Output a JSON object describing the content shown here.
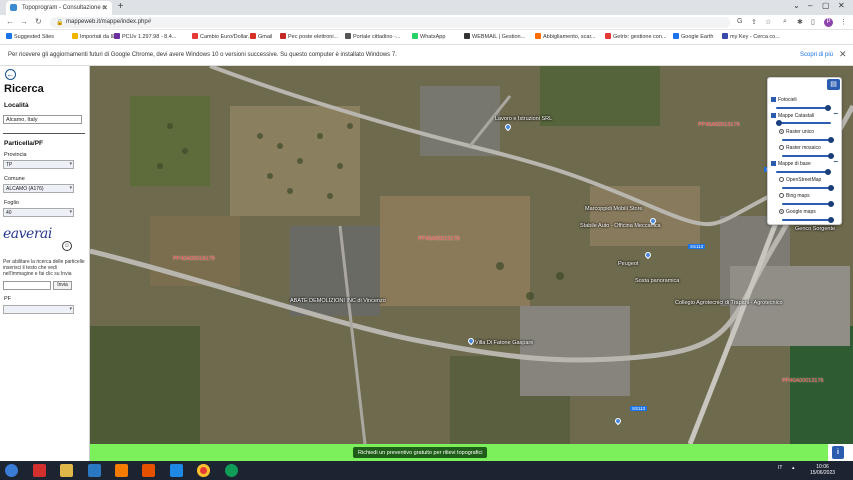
{
  "browser": {
    "tab_title": "Topoprogram - Consultazione n",
    "url": "mappeweb.it/mappe/index.php#",
    "profile_initial": "P"
  },
  "bookmarks": [
    {
      "label": "Suggested Sites",
      "color": "#1a73e8"
    },
    {
      "label": "Importati da IE",
      "color": "#f2b600"
    },
    {
      "label": "PCUv 1.297.98 - 8.4...",
      "color": "#6b2fa0"
    },
    {
      "label": "Cambio Euro/Dollar...",
      "color": "#e53935"
    },
    {
      "label": "Gmail",
      "color": "#d93025"
    },
    {
      "label": "Pec poste elettroni...",
      "color": "#c62828"
    },
    {
      "label": "Portale cittadino -...",
      "color": "#555555"
    },
    {
      "label": "WhatsApp",
      "color": "#25d366"
    },
    {
      "label": "WEBMAIL | Gestion...",
      "color": "#333333"
    },
    {
      "label": "Abbigliamento, scar...",
      "color": "#ff6d00"
    },
    {
      "label": "Getrix: gestione con...",
      "color": "#e53935"
    },
    {
      "label": "Google Earth",
      "color": "#1a73e8"
    },
    {
      "label": "my Key - Cerca co...",
      "color": "#3949ab"
    }
  ],
  "infobar": {
    "message": "Per ricevere gli aggiornamenti futuri di Google Chrome, devi avere Windows 10 o versioni successive. Su questo computer è installato Windows 7.",
    "link": "Scopri di più"
  },
  "sidebar": {
    "title": "Ricerca",
    "localita_heading": "Località",
    "localita_value": "Alcamo, Italy",
    "particella_heading": "Particella/PF",
    "provincia_label": "Provincia",
    "provincia_value": "TP",
    "comune_label": "Comune",
    "comune_value": "ALCAMO (A176)",
    "foglio_label": "Foglio",
    "foglio_value": "40",
    "captcha_text": "eaverai",
    "captcha_note": "Per abilitare la ricerca delle particelle inserisci il testo che vedi nell'immagine e fai clic su Invia",
    "invia_label": "Invia",
    "pf_label": "PF"
  },
  "map": {
    "labels": [
      {
        "text": "Lavoro e Istruzioni SRL",
        "kind": "place"
      },
      {
        "text": "Marcoppidi Mobili Store",
        "kind": "place"
      },
      {
        "text": "Stabile Auto - Officina Meccanica",
        "kind": "place"
      },
      {
        "text": "Peugeot",
        "kind": "place"
      },
      {
        "text": "Sosta panoramica",
        "kind": "place"
      },
      {
        "text": "ABATE DEMOLIZIONI INC di Vincenzo",
        "kind": "place"
      },
      {
        "text": "Villa Di Fatone Gaspare",
        "kind": "place"
      },
      {
        "text": "Genco Sorgente",
        "kind": "place"
      },
      {
        "text": "Collegio Agrotecnici di Trapani - Agrotecnico",
        "kind": "place"
      },
      {
        "text": "PP40A00013179",
        "kind": "parcel"
      },
      {
        "text": "PP40A00013178",
        "kind": "parcel"
      },
      {
        "text": "PP40A00016179",
        "kind": "parcel"
      },
      {
        "text": "PP40A00013176",
        "kind": "parcel"
      }
    ],
    "road_tags": [
      "SS113",
      "SS113",
      "SS113"
    ]
  },
  "layers": {
    "fotocieli": "Fotocieli",
    "mappe_catastali": "Mappe Catastali",
    "raster_unico": "Raster unico",
    "raster_mosaico": "Raster mosaico",
    "mappe_di_base": "Mappe di base",
    "openstreetmap": "OpenStreetMap",
    "bing_maps": "Bing maps",
    "google_maps": "Google maps",
    "selected_base": "Google maps",
    "slider_levels": [
      0.85,
      0.85,
      0.85,
      0.85,
      0.85,
      0.85,
      0.85,
      0.85
    ]
  },
  "banner": {
    "text": "Richiedi un preventivo gratuito per rilievi topografici"
  },
  "taskbar": {
    "lang": "IT",
    "time": "10:06",
    "date": "15/06/2023"
  }
}
